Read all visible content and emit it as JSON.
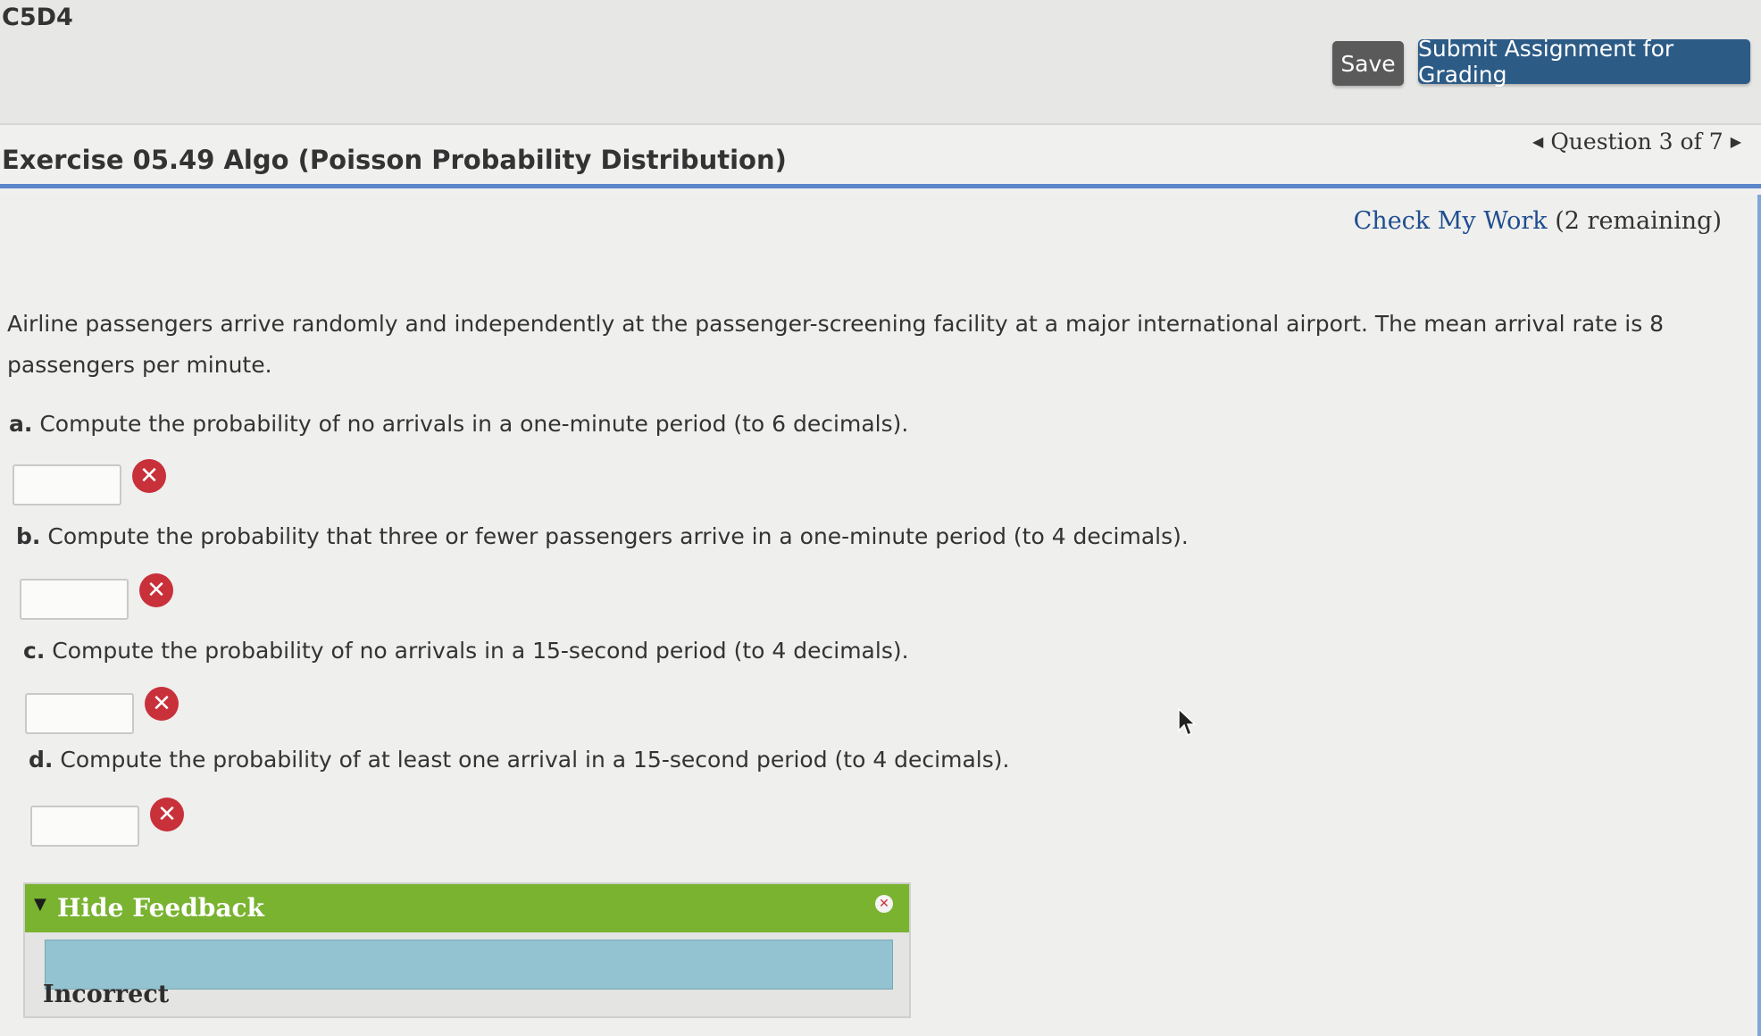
{
  "header": {
    "course_code": "C5D4",
    "save_label": "Save",
    "submit_label": "Submit Assignment for Grading"
  },
  "exercise": {
    "title": "Exercise 05.49 Algo (Poisson Probability Distribution)",
    "question_nav": "Question 3 of 7",
    "check_work_link": "Check My Work",
    "check_work_remaining": "(2 remaining)"
  },
  "problem": {
    "text": "Airline passengers arrive randomly and independently at the passenger-screening facility at a major international airport. The mean arrival rate is 8 passengers per minute.",
    "parts": [
      {
        "letter": "a.",
        "text": "Compute the probability of no arrivals in a one-minute period (to 6 decimals).",
        "value": "",
        "status": "incorrect"
      },
      {
        "letter": "b.",
        "text": "Compute the probability that three or fewer passengers arrive in a one-minute period (to 4 decimals).",
        "value": "",
        "status": "incorrect"
      },
      {
        "letter": "c.",
        "text": "Compute the probability of no arrivals in a 15-second period (to 4 decimals).",
        "value": "",
        "status": "incorrect"
      },
      {
        "letter": "d.",
        "text": "Compute the probability of at least one arrival in a 15-second period (to 4 decimals).",
        "value": "",
        "status": "incorrect"
      }
    ]
  },
  "feedback": {
    "toggle_label": "Hide Feedback",
    "status": "Incorrect"
  },
  "icons": {
    "error": "x-circle-icon",
    "prev": "triangle-left-icon",
    "next": "triangle-right-icon",
    "collapse": "triangle-down-icon",
    "close": "close-icon",
    "cursor": "mouse-pointer-icon"
  },
  "colors": {
    "submit_button": "#2c5b86",
    "save_button": "#5a5a5a",
    "title_rule": "#5b86c9",
    "error": "#c8303a",
    "feedback_header": "#79b330",
    "feedback_body": "#93c2d0",
    "link": "#1f4e8f"
  }
}
